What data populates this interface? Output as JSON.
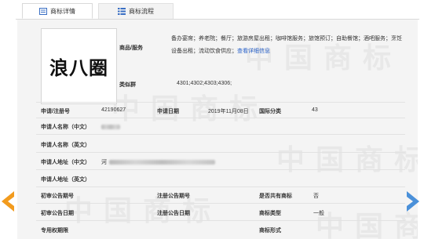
{
  "tabs": [
    {
      "label": "商标详情",
      "icon": "list-icon"
    },
    {
      "label": "商标流程",
      "icon": "grid-icon"
    }
  ],
  "trademark": {
    "name": "浪八圈",
    "goods_label": "商品/服务",
    "goods_text": "备办宴席；养老院；餐厅；旅游房屋出租；咖啡馆服务；旅馆预订；自助餐馆；酒吧服务；烹饪设备出租；流动饮食供应；",
    "goods_link": "查看详细信息",
    "similar_label": "类似群",
    "similar_value": "4301;4302;4303;4306;"
  },
  "fields": {
    "reg_no_label": "申请/注册号",
    "reg_no": "42190627",
    "apply_date_label": "申请日期",
    "apply_date": "2019年11月08日",
    "intl_class_label": "国际分类",
    "intl_class": "43",
    "applicant_cn_label": "申请人名称（中文）",
    "applicant_en_label": "申请人名称（英文）",
    "address_cn_label": "申请人地址（中文）",
    "address_cn_prefix": "河",
    "address_en_label": "申请人地址（英文）",
    "first_pub_no_label": "初审公告期号",
    "reg_pub_no_label": "注册公告期号",
    "shared_label": "是否共有商标",
    "shared_value": "否",
    "first_pub_date_label": "初审公告日期",
    "reg_pub_date_label": "注册公告日期",
    "tm_type_label": "商标类型",
    "tm_type_value": "一般",
    "exclusive_label": "专用权期限",
    "tm_form_label": "商标形式"
  },
  "colors": {
    "left_arrow": "#f29b1e",
    "right_arrow": "#4a90d9",
    "link": "#2a62c9"
  }
}
